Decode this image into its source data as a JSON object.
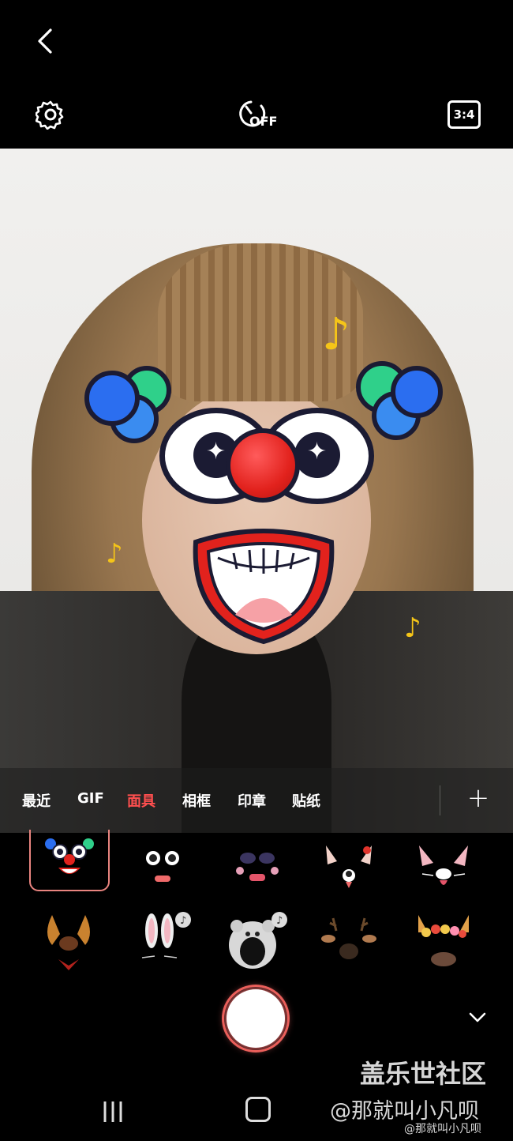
{
  "topbar": {
    "back_icon": "chevron-left-icon",
    "settings_icon": "gear-icon",
    "timer_label": "OFF",
    "ratio_label": "3:4"
  },
  "tabs": {
    "items": [
      {
        "label": "最近",
        "active": false
      },
      {
        "label": "GIF",
        "active": false
      },
      {
        "label": "面具",
        "active": true
      },
      {
        "label": "相框",
        "active": false
      },
      {
        "label": "印章",
        "active": false
      },
      {
        "label": "贴纸",
        "active": false
      }
    ],
    "add_label": "+"
  },
  "stickers": {
    "row1": [
      "clown-mask",
      "surprised-face-mask",
      "sleepy-face-mask",
      "panda-ears-mask",
      "pig-ears-mask"
    ],
    "row2": [
      "puppy-ears-mask",
      "bunny-ears-mask",
      "bear-head-mask",
      "reindeer-mask",
      "flower-crown-mask"
    ],
    "selected_index": 0
  },
  "colors": {
    "active_tab": "#ff4f4f",
    "selected_border": "#e9847f",
    "shutter_glow": "#e35b55"
  },
  "watermark": {
    "site": "盖乐世社区",
    "author": "@那就叫小凡呗",
    "weibo": "@那就叫小凡呗"
  }
}
